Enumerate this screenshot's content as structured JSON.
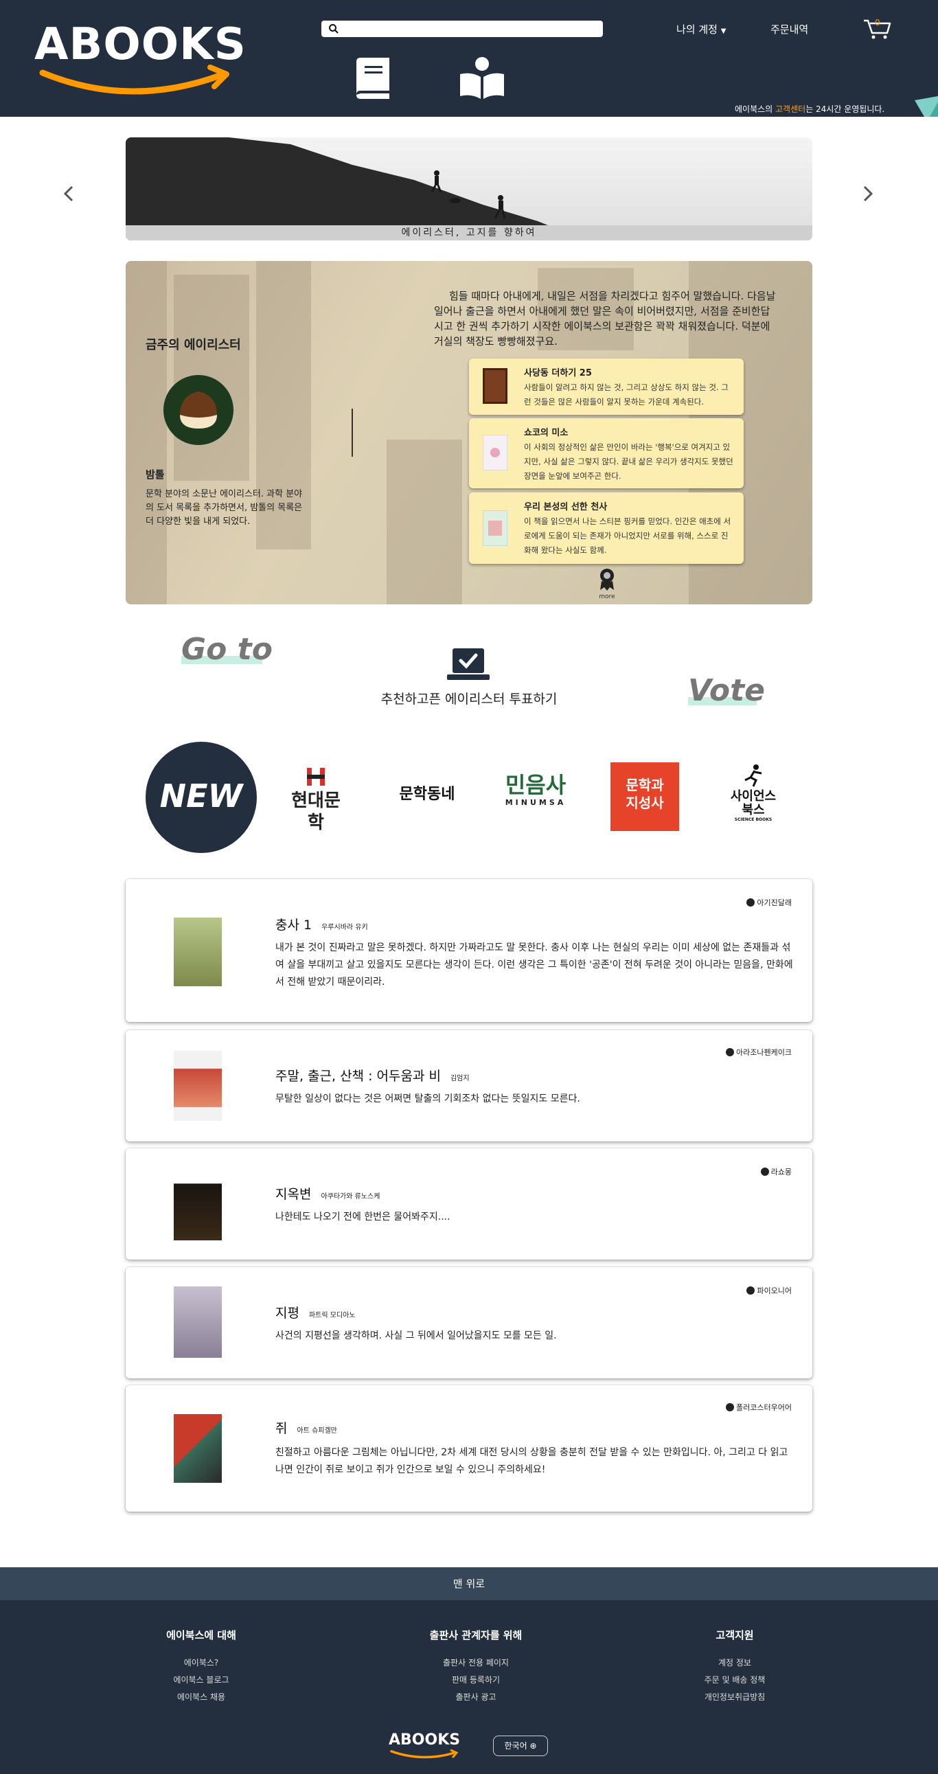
{
  "header": {
    "logo_text": "ABOOKS",
    "search_placeholder": "",
    "account_label": "나의 계정",
    "orders_label": "주문내역",
    "cart_count": "0",
    "notice_prefix": "에이북스의 ",
    "notice_highlight": "고객센터",
    "notice_suffix": "는 24시간 운영됩니다."
  },
  "banner": {
    "caption": "에이리스터, 고지를 향하여"
  },
  "hero": {
    "week_title": "금주의 에이리스터",
    "curator_name": "밤톨",
    "curator_desc": "문학 분야의 소문난 에이리스터. 과학 분야의 도서 목록을 추가하면서, 밤톨의 목록은 더 다양한 빛을 내게 되었다.",
    "quote": "힘들 때마다 아내에게, 내일은 서점을 차리겠다고 힘주어 말했습니다. 다음날 일어나 출근을 하면서 아내에게 했던 말은 속이 비어버렸지만, 서점을 준비한답시고 한 권씩 추가하기 시작한 에이북스의 보관함은 꽉꽉 채워졌습니다. 덕분에 거실의 책장도 빵빵해졌구요.",
    "cards": [
      {
        "title": "사당동 더하기 25",
        "desc": "사람들이 알려고 하지 않는 것, 그리고 상상도 하지 않는 것. 그런 것들은 많은 사람들이 알지 못하는 가운데 계속된다."
      },
      {
        "title": "쇼코의 미소",
        "desc": "이 사회의 정상적인 삶은 만인이 바라는 '행복'으로 여겨지고 있지만, 사실 삶은 그렇지 않다. 끝내 삶은 우리가 생각지도 못했던 장면을 눈앞에 보여주곤 한다."
      },
      {
        "title": "우리 본성의 선한 천사",
        "desc": "이 책을 읽으면서 나는 스티븐 핑커를 믿었다. 인간은 애초에 서로에게 도움이 되는 존재가 아니었지만 서로를 위해, 스스로 진화해 왔다는 사실도 함께."
      }
    ],
    "more_label": "more"
  },
  "vote": {
    "goto_text": "Go to",
    "vote_text": "Vote",
    "cta_label": "추천하고픈 에이리스터 투표하기"
  },
  "publishers": {
    "new_label": "NEW",
    "hyundai": "현대문학",
    "munhakdongne": "문학동네",
    "minumsa": "민음사",
    "minumsa_sub": "MINUMSA",
    "moonji_line1": "문학과",
    "moonji_line2": "지성사",
    "science_line1": "사이언스",
    "science_line2": "북스",
    "science_small": "SCIENCE BOOKS"
  },
  "reviews": [
    {
      "title": "충사 1",
      "author": "우루시바라 유키",
      "user": "아기진달래",
      "body": "내가 본 것이 진짜라고 말은 못하겠다. 하지만 가짜라고도 말 못한다. 충사 이후 나는 현실의 우리는 이미 세상에 없는 존재들과 섞여 살을 부대끼고 살고 있을지도 모른다는 생각이 든다. 이런 생각은 그 특이한 '공존'이 전혀 두려운 것이 아니라는 믿음을, 만화에서 전해 받았기 때문이리라."
    },
    {
      "title": "주말, 출근, 산책 : 어두움과 비",
      "author": "김엄지",
      "user": "아라조나펜케이크",
      "body": "무탈한 일상이 없다는 것은 어쩌면 탈출의 기회조차 없다는 뜻일지도 모른다."
    },
    {
      "title": "지옥변",
      "author": "아쿠타가와 류노스케",
      "user": "라쇼몽",
      "body": "나한테도 나오기 전에 한번은 물어봐주지...."
    },
    {
      "title": "지평",
      "author": "파트릭 모디아노",
      "user": "파이오니어",
      "body": "사건의 지평선을 생각하며. 사실 그 뒤에서 일어났을지도 모를 모든 일."
    },
    {
      "title": "쥐",
      "author": "아트 슈피겔만",
      "user": "폴러코스터우어어",
      "body": "친절하고 아름다운 그림체는 아닙니다만, 2차 세계 대전 당시의 상황을 충분히 전달 받을 수 있는 만화입니다. 아, 그리고 다 읽고 나면 인간이 쥐로 보이고 쥐가 인간으로 보일 수 있으니 주의하세요!"
    }
  ],
  "footer": {
    "to_top": "맨 위로",
    "col1": {
      "title": "에이북스에 대해",
      "links": [
        "에이북스?",
        "에이북스 블로그",
        "에이북스 채용"
      ]
    },
    "col2": {
      "title": "출판사 관계자를 위해",
      "links": [
        "출판사 전용 페이지",
        "판매 등록하기",
        "출판사 광고"
      ]
    },
    "col3": {
      "title": "고객지원",
      "links": [
        "계정 정보",
        "주문 및 배송 정책",
        "개인정보취급방침"
      ]
    },
    "logo_text": "ABOOKS",
    "lang_label": "한국어"
  },
  "colors": {
    "header_bg": "#232f3e",
    "accent": "#f90",
    "card_bg": "#fbeeb0",
    "mint": "#c7eee0"
  }
}
